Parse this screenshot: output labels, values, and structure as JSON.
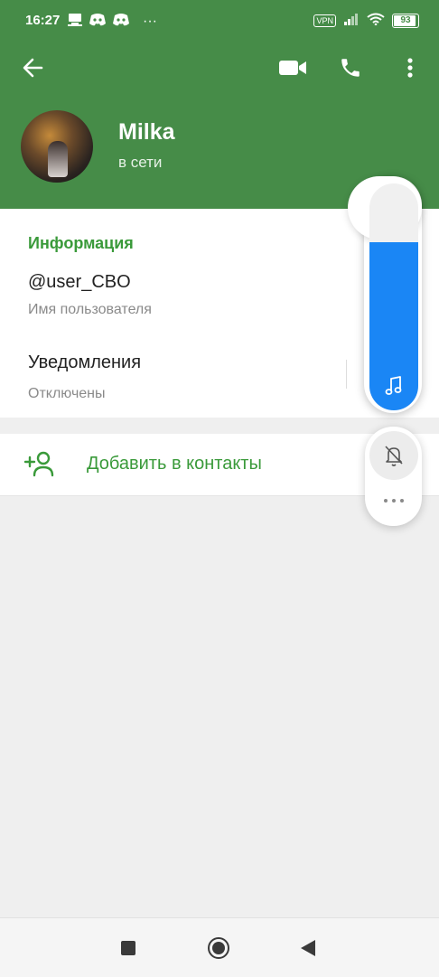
{
  "status_bar": {
    "time": "16:27",
    "extra_dots": "···",
    "vpn": "VPN",
    "battery": "93",
    "battery_level": 0.93
  },
  "header": {
    "name": "Milka",
    "status": "в сети",
    "color": "#468c48"
  },
  "info": {
    "section_title": "Информация",
    "username_value": "@user_CBO",
    "username_label": "Имя пользователя",
    "notifications_value": "Уведомления",
    "notifications_label": "Отключены"
  },
  "actions": {
    "add_contact": "Добавить в контакты"
  },
  "volume_panel": {
    "level": 0.74,
    "accent": "#1a86f5",
    "icons": [
      "music-note-icon",
      "bell-off-icon",
      "more-dots-icon"
    ]
  }
}
